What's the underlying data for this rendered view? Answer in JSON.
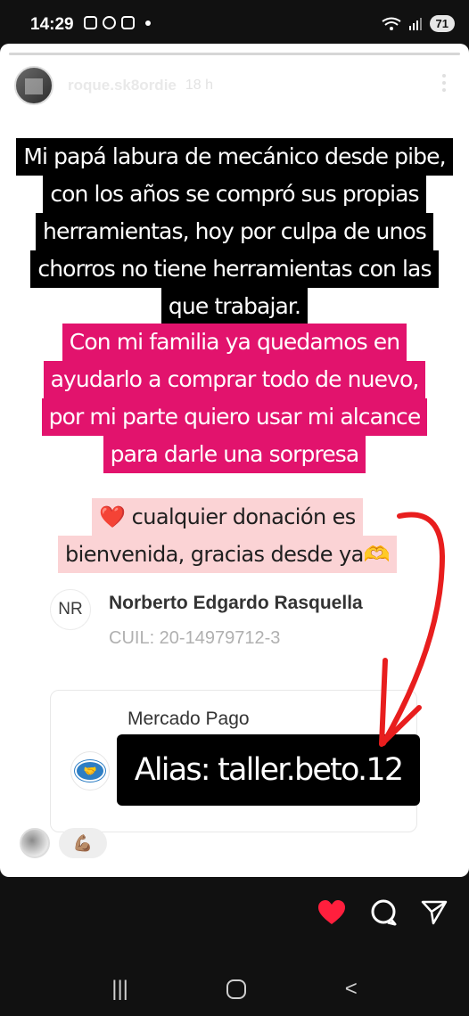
{
  "status_bar": {
    "time": "14:29",
    "battery": "71"
  },
  "story": {
    "username": "roque.sk8ordie",
    "time_ago": "18 h",
    "black_text": [
      "Mi papá labura de mecánico desde pibe,",
      "con los años se compró sus propias",
      "herramientas, hoy por culpa de unos",
      "chorros no tiene herramientas con las",
      "que trabajar."
    ],
    "pink_text": [
      "Con mi familia ya quedamos en",
      "ayudarlo a comprar todo de nuevo,",
      "por mi parte quiero usar mi alcance",
      "para darle una sorpresa"
    ],
    "donation_text": [
      "❤️ cualquier donación es",
      "bienvenida, gracias desde ya🫶"
    ],
    "recipient": {
      "initials": "NR",
      "name": "Norberto Edgardo Rasquella",
      "cuil": "CUIL: 20-14979712-3"
    },
    "payment": {
      "provider": "Mercado Pago",
      "alias": "Alias: taller.beto.12"
    },
    "reaction": "💪🏽"
  },
  "colors": {
    "pink": "#e2136d",
    "light_pink": "#fbd3d5",
    "arrow_red": "#e81e1e",
    "heart": "#ff1f3d"
  },
  "icons": [
    "wifi-icon",
    "signal-icon",
    "menu-dots-icon",
    "heart-icon",
    "comment-icon",
    "share-icon",
    "mercado-pago-logo-icon"
  ]
}
